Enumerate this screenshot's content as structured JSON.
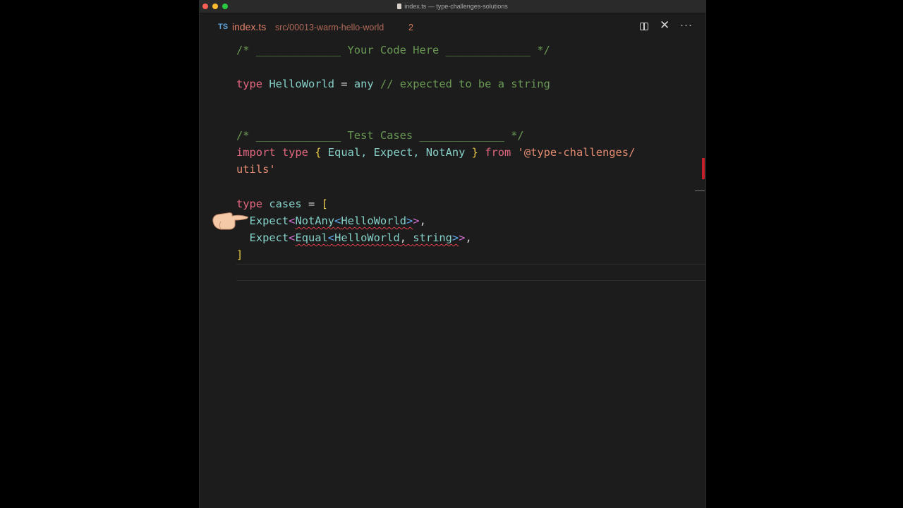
{
  "window": {
    "title": "index.ts — type-challenges-solutions"
  },
  "tab": {
    "lang_badge": "TS",
    "file_name": "index.ts",
    "path": "src/00013-warm-hello-world",
    "problem_count": "2"
  },
  "actions": {
    "close_glyph": "✕",
    "more_glyph": "···"
  },
  "code": {
    "l1_comment": "/* _____________ Your Code Here _____________ */",
    "l3_kw": "type",
    "l3_name": "HelloWorld",
    "l3_eq": " = ",
    "l3_any": "any",
    "l3_comment": " // expected to be a string",
    "l6_comment": "/* _____________ Test Cases _____________ */",
    "l7_import": "import",
    "l7_type": " type",
    "l7_brace_open": "{",
    "l7_names": " Equal, Expect, NotAny ",
    "l7_brace_close": "}",
    "l7_from": " from",
    "l7_str_a": "'@type-challenges/",
    "l8_str_b": "utils'",
    "l10_kw": "type",
    "l10_name": " cases",
    "l10_eq": " = ",
    "l10_bracket": "[",
    "l11_expect": "Expect",
    "l11_lt": "<",
    "l11_notany": "NotAny",
    "l11_lt2": "<",
    "l11_hw": "HelloWorld",
    "l11_gt2": ">",
    "l11_gt": ">",
    "l11_comma": ",",
    "l12_expect": "Expect",
    "l12_lt": "<",
    "l12_equal": "Equal",
    "l12_lt2": "<",
    "l12_hw": "HelloWorld",
    "l12_sep": ", ",
    "l12_string": "string",
    "l12_gt2": ">",
    "l12_gt": ">",
    "l12_comma": ",",
    "l13_bracket": "]"
  },
  "colors": {
    "keyword": "#e3677f",
    "type": "#86d0c8",
    "comment": "#6a9955",
    "string": "#e58b70",
    "error": "#e0404a"
  },
  "icons": [
    "split-editor-icon",
    "close-icon",
    "more-actions-icon",
    "pointing-hand-icon"
  ]
}
